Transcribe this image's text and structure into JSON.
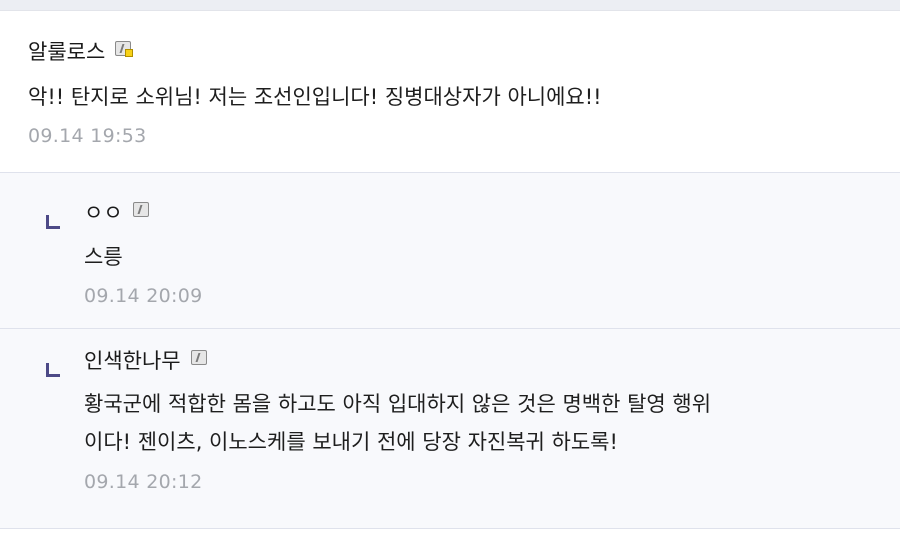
{
  "comments": [
    {
      "nickname": "알룰로스",
      "icon": "gallog-icon-fixed",
      "text": "악!! 탄지로 소위님! 저는 조선인입니다! 징병대상자가 아니에요!!",
      "time": "09.14 19:53"
    }
  ],
  "replies": [
    {
      "nickname": "ㅇㅇ",
      "icon": "gallog-icon",
      "text": "스릉",
      "time": "09.14 20:09"
    },
    {
      "nickname": "인색한나무",
      "icon": "gallog-icon",
      "text_lines": [
        "황국군에 적합한 몸을 하고도 아직 입대하지 않은 것은 명백한 탈영 행위",
        "이다! 젠이츠, 이노스케를 보내기 전에 당장 자진복귀 하도록!"
      ],
      "time": "09.14 20:12"
    }
  ],
  "colors": {
    "reply_marker": "#4d4a87",
    "timestamp": "#a4a7ad",
    "reply_background": "#f8f9fc"
  }
}
